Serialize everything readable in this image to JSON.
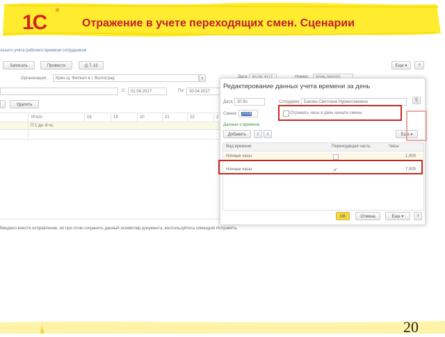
{
  "slide": {
    "title": "Отражение в учете переходящих смен. Сценарии",
    "page_number": "20",
    "logo_text": "1С",
    "logo_mark": "®"
  },
  "doc": {
    "breadcrumb": "льного учета рабочего времени сотрудников",
    "buttons": {
      "save": "Записать",
      "post": "Провести",
      "print": "Т-13",
      "more": "Еще"
    },
    "help": "?",
    "date_label": "Дата:",
    "date_value": "30.09.2017",
    "number_label": "Номер:",
    "number_value": "0036-000003",
    "org_label": "Организация:",
    "org_value": "Крен-Ц. Филиал в г. Волгоград",
    "period_from_label": "С:",
    "period_from": "01.04.2017",
    "period_to_label": "По:",
    "period_to": "30.04.2017",
    "delete_btn": "Удалить",
    "grid_headers": [
      "Итого",
      "18",
      "19",
      "20",
      "21",
      "22",
      "2"
    ],
    "total_value": "П 1 дн. 8 чс.",
    "status_text": "Введено внести исправление, но при этом сохранить данный экземпляр документа, воспользуйтесь командой Исправить."
  },
  "dialog": {
    "title": "Редактирование данных учета времени за день",
    "date_label": "Дата:",
    "date_value": "30 Вс",
    "employee_label": "Сотрудник:",
    "employee_value": "Бакова Светлана Нурмиламовна",
    "shift_label": "Смена:",
    "shift_value": "2018",
    "checkbox_label": "Отражать часы в день начала смены",
    "section_label": "Данные о времени",
    "add_btn": "Добавить",
    "more_btn": "Еще",
    "columns": [
      "Вид времени",
      "Переходящая часть",
      "Часы"
    ],
    "rows": [
      {
        "type": "Ночные часы",
        "carry": false,
        "hours": "1,000"
      },
      {
        "type": "Ночные часы",
        "carry": true,
        "hours": "7,000"
      }
    ],
    "ok_btn": "ОК",
    "cancel_btn": "Отмена",
    "footer_more": "Еще",
    "help": "?"
  },
  "colors": {
    "accent": "#c0202a",
    "banner": "#ffec2e",
    "ok": "#f7d84a",
    "highlight": "#c6281f"
  }
}
